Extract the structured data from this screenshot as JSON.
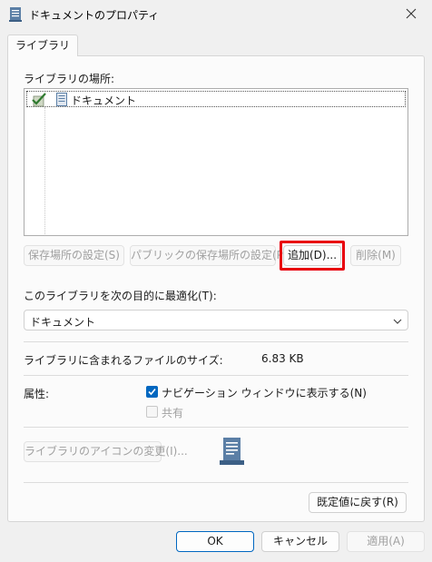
{
  "window": {
    "title": "ドキュメントのプロパティ",
    "close_icon": "close-icon",
    "title_icon": "document-library-icon"
  },
  "tabs": [
    {
      "label": "ライブラリ",
      "active": true
    }
  ],
  "library_locations": {
    "label": "ライブラリの場所:",
    "items": [
      {
        "name": "ドキュメント",
        "icon": "document-folder-icon",
        "default_save": true
      }
    ]
  },
  "location_buttons": {
    "set_save_location": "保存場所の設定(S)",
    "set_public_save_location": "パブリックの保存場所の設定(P)",
    "add": "追加(D)...",
    "remove": "削除(M)"
  },
  "optimize": {
    "label": "このライブラリを次の目的に最適化(T):",
    "selected": "ドキュメント"
  },
  "size": {
    "label": "ライブラリに含まれるファイルのサイズ:",
    "value": "6.83 KB"
  },
  "attributes": {
    "label": "属性:",
    "show_in_navigation": {
      "label": "ナビゲーション ウィンドウに表示する(N)",
      "checked": true
    },
    "shared": {
      "label": "共有",
      "checked": false
    }
  },
  "change_icon_button": "ライブラリのアイコンの変更(I)...",
  "restore_defaults_button": "既定値に戻す(R)",
  "footer": {
    "ok": "OK",
    "cancel": "キャンセル",
    "apply": "適用(A)"
  },
  "colors": {
    "accent": "#0067c0",
    "highlight_border": "#e8000d",
    "disabled_text": "#a0a0a0"
  }
}
